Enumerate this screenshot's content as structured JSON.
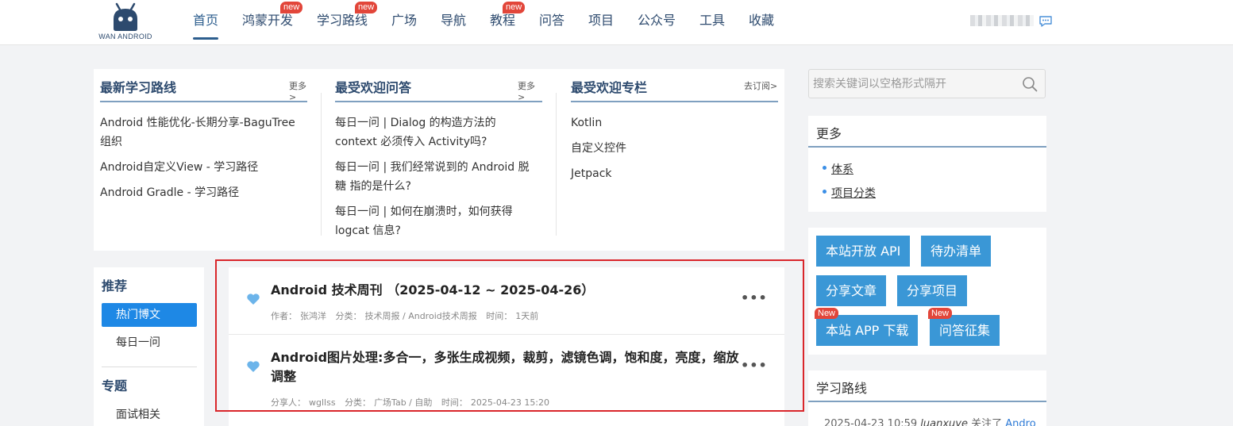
{
  "logo": {
    "text": "WAN ANDROID"
  },
  "nav": [
    {
      "label": "首页",
      "badge": ""
    },
    {
      "label": "鸿蒙开发",
      "badge": "new"
    },
    {
      "label": "学习路线",
      "badge": "new"
    },
    {
      "label": "广场",
      "badge": ""
    },
    {
      "label": "导航",
      "badge": ""
    },
    {
      "label": "教程",
      "badge": "new"
    },
    {
      "label": "问答",
      "badge": ""
    },
    {
      "label": "项目",
      "badge": ""
    },
    {
      "label": "公众号",
      "badge": ""
    },
    {
      "label": "工具",
      "badge": ""
    },
    {
      "label": "收藏",
      "badge": ""
    }
  ],
  "top": {
    "routes": {
      "title": "最新学习路线",
      "more": "更多>",
      "items": [
        "Android 性能优化-长期分享-BaguTree组织",
        "Android自定义View - 学习路径",
        "Android Gradle - 学习路径"
      ]
    },
    "qa": {
      "title": "最受欢迎问答",
      "more": "更多>",
      "items": [
        "每日一问 | Dialog 的构造方法的 context 必须传入 Activity吗?",
        "每日一问 | 我们经常说到的 Android 脱糖 指的是什么?",
        "每日一问 | 如何在崩溃时，如何获得logcat 信息?"
      ]
    },
    "columns": {
      "title": "最受欢迎专栏",
      "more": "去订阅>",
      "items": [
        "Kotlin",
        "自定义控件",
        "Jetpack"
      ]
    }
  },
  "left": {
    "recommend_title": "推荐",
    "recommend_items": [
      "热门博文",
      "每日一问"
    ],
    "topic_title": "专题",
    "topic_items": [
      "面试相关"
    ]
  },
  "articles": [
    {
      "title": "Android 技术周刊 （2025-04-12 ~ 2025-04-26）",
      "author_label": "作者：",
      "author": "张鸿洋",
      "category_label": "分类：",
      "category": "技术周报 / Android技术周报",
      "time_label": "时间：",
      "time": "1天前",
      "more": "•••"
    },
    {
      "title": "Android图片处理:多合一，多张生成视频，裁剪，滤镜色调，饱和度，亮度，缩放调整",
      "author_label": "分享人：",
      "author": "wgllss",
      "category_label": "分类：",
      "category": "广场Tab / 自助",
      "time_label": "时间：",
      "time": "2025-04-23 15:20",
      "more": "•••"
    }
  ],
  "search": {
    "placeholder": "搜索关键词以空格形式隔开"
  },
  "more_card": {
    "title": "更多",
    "items": [
      "体系",
      "项目分类"
    ]
  },
  "buttons": [
    {
      "label": "本站开放 API",
      "badge": ""
    },
    {
      "label": "待办清单",
      "badge": ""
    },
    {
      "label": "分享文章",
      "badge": ""
    },
    {
      "label": "分享项目",
      "badge": ""
    },
    {
      "label": "本站 APP 下载",
      "badge": "New"
    },
    {
      "label": "问答征集",
      "badge": "New"
    }
  ],
  "route_card": {
    "title": "学习路线",
    "entry": {
      "time": "2025-04-23 10:59",
      "user": "luanxuye",
      "action": "关注了",
      "target": "Andro"
    }
  },
  "colors": {
    "accent": "#2d4a6e",
    "button": "#3a97d6",
    "badge": "#e2463a",
    "highlight": "#d9262b"
  }
}
